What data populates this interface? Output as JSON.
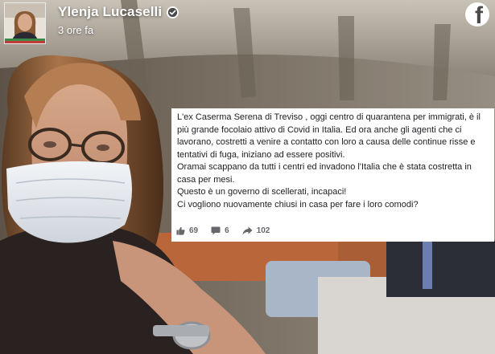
{
  "post": {
    "author": "Ylenja Lucaselli",
    "timestamp": "3 ore fa",
    "verified": true,
    "paragraphs": [
      "L'ex Caserma Serena di Treviso , oggi centro di quarantena per immigrati, è il più grande focolaio attivo di Covid in Italia. Ed ora anche gli agenti che ci lavorano, costretti a venire a contatto con loro a causa delle continue risse e tentativi di fuga, iniziano ad essere positivi.",
      "Oramai scappano da tutti i centri ed invadono l'Italia che è stata costretta in casa per mesi.",
      "Questo è un governo di scellerati, incapaci!",
      "Ci vogliono nuovamente chiusi in casa per fare i loro comodi?"
    ],
    "reactions": {
      "icon": "thumbs-up-icon",
      "count": "69"
    },
    "comments": {
      "icon": "comment-icon",
      "count": "6"
    },
    "shares": {
      "icon": "share-arrow-icon",
      "count": "102"
    }
  },
  "brand": {
    "icon": "facebook-logo-icon",
    "color": "#4a4a4a"
  },
  "colors": {
    "card_background": "#ffffff",
    "text": "#1c1e21",
    "meta_text": "#65676b",
    "header_text": "#ffffff"
  }
}
